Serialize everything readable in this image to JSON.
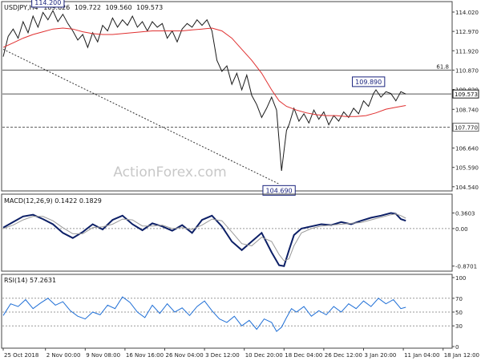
{
  "chart_data": [
    {
      "type": "line",
      "panel": "price",
      "instrument": "USDJPY,H4",
      "ohlc_readout": [
        "109.626",
        "109.722",
        "109.560",
        "109.573"
      ],
      "watermark": "ActionForex.com",
      "ylim": [
        104.4,
        114.5
      ],
      "y_ticks": [
        "114.020",
        "112.970",
        "111.920",
        "110.870",
        "109.820",
        "108.740",
        "107.690",
        "106.640",
        "105.590",
        "104.540"
      ],
      "series": [
        {
          "name": "",
          "color": "#1a1a1a",
          "x": [
            0,
            4,
            8,
            12,
            16,
            20,
            24,
            28,
            32,
            36,
            40,
            44,
            48,
            52,
            56,
            60,
            64,
            68,
            72,
            76,
            80,
            84,
            88,
            92,
            96,
            100,
            104,
            108,
            112,
            116,
            120,
            124,
            128,
            132,
            136,
            140,
            144,
            148,
            152,
            156,
            160,
            164,
            168,
            172,
            176,
            180,
            184,
            188,
            192,
            196,
            200,
            204,
            208,
            212,
            216,
            220,
            224,
            228,
            230,
            234,
            238,
            242,
            246,
            250,
            254,
            258,
            262,
            266,
            270,
            274,
            278,
            282,
            286,
            290,
            294,
            298,
            300,
            304,
            308,
            312,
            316,
            320,
            324
          ],
          "values": [
            111.6,
            112.7,
            113.1,
            112.6,
            113.5,
            112.9,
            113.8,
            113.2,
            114.0,
            113.6,
            114.1,
            113.5,
            113.9,
            113.4,
            113.0,
            112.5,
            112.8,
            112.1,
            112.9,
            112.4,
            113.3,
            113.0,
            113.7,
            113.2,
            113.6,
            113.3,
            113.8,
            113.2,
            113.5,
            113.0,
            113.5,
            113.2,
            113.4,
            112.6,
            113.0,
            112.4,
            113.1,
            113.4,
            113.2,
            113.6,
            113.3,
            113.6,
            113.0,
            111.4,
            110.8,
            111.1,
            110.1,
            110.7,
            109.8,
            110.6,
            109.5,
            109.0,
            108.3,
            108.8,
            109.4,
            108.7,
            105.4,
            107.6,
            107.9,
            108.8,
            108.1,
            108.5,
            108.0,
            108.7,
            108.2,
            108.6,
            107.9,
            108.4,
            108.1,
            108.6,
            108.3,
            108.8,
            108.5,
            109.2,
            108.9,
            109.6,
            109.8,
            109.4,
            109.7,
            109.6,
            109.2,
            109.7,
            109.57
          ]
        },
        {
          "name": "",
          "color": "#e03030",
          "x": [
            0,
            8,
            16,
            24,
            32,
            40,
            48,
            56,
            64,
            72,
            80,
            88,
            96,
            104,
            112,
            120,
            128,
            136,
            144,
            152,
            160,
            168,
            176,
            184,
            192,
            200,
            208,
            216,
            222,
            228,
            236,
            244,
            252,
            260,
            268,
            276,
            284,
            292,
            300,
            308,
            316,
            324
          ],
          "values": [
            112.1,
            112.35,
            112.6,
            112.8,
            112.95,
            113.1,
            113.15,
            113.1,
            112.95,
            112.85,
            112.8,
            112.8,
            112.85,
            112.9,
            112.95,
            113.0,
            113.0,
            113.0,
            113.0,
            113.05,
            113.1,
            113.15,
            113.0,
            112.6,
            112.0,
            111.4,
            110.7,
            109.8,
            109.2,
            108.9,
            108.7,
            108.55,
            108.45,
            108.4,
            108.4,
            108.35,
            108.35,
            108.4,
            108.55,
            108.75,
            108.85,
            108.95
          ]
        }
      ],
      "annotations": [
        {
          "label": "114.200",
          "x": 36,
          "y": 114.2
        },
        {
          "label": "104.690",
          "x": 222,
          "y": 104.69
        },
        {
          "label": "109.890",
          "x": 294,
          "y": 109.89
        }
      ],
      "price_tags": [
        {
          "label": "109.573",
          "y": 109.573,
          "kind": "current"
        },
        {
          "label": "107.770",
          "y": 107.77,
          "kind": "support"
        }
      ],
      "levels": [
        {
          "label": "61.8",
          "y": 110.87,
          "style": "solid"
        },
        {
          "label": "",
          "y": 109.573,
          "style": "solid"
        },
        {
          "label": "",
          "y": 107.77,
          "style": "dashed"
        }
      ],
      "trendline": {
        "x": [
          0,
          222
        ],
        "values": [
          112.0,
          104.69
        ]
      }
    },
    {
      "type": "line",
      "panel": "macd",
      "title": "MACD(12,26,9) 0.1422 0.1829",
      "ylim": [
        -0.95,
        0.5
      ],
      "y_ticks": [
        {
          "label": "0.3603",
          "value": 0.3603
        },
        {
          "label": "0.00",
          "value": 0.0
        },
        {
          "label": "-0.8701",
          "value": -0.8701
        }
      ],
      "series": [
        {
          "name": "",
          "color": "#0c1f66",
          "x": [
            0,
            8,
            16,
            24,
            32,
            40,
            48,
            56,
            64,
            72,
            80,
            88,
            96,
            104,
            112,
            120,
            128,
            136,
            144,
            152,
            160,
            168,
            176,
            184,
            192,
            200,
            208,
            216,
            222,
            226,
            230,
            234,
            240,
            248,
            256,
            264,
            272,
            280,
            288,
            296,
            304,
            312,
            316,
            320,
            324
          ],
          "values": [
            0.02,
            0.15,
            0.28,
            0.32,
            0.22,
            0.1,
            -0.1,
            -0.22,
            -0.08,
            0.1,
            -0.02,
            0.2,
            0.3,
            0.1,
            -0.04,
            0.12,
            0.05,
            -0.05,
            0.08,
            -0.1,
            0.2,
            0.3,
            0.05,
            -0.3,
            -0.5,
            -0.3,
            -0.1,
            -0.55,
            -0.85,
            -0.87,
            -0.5,
            -0.15,
            0.0,
            0.05,
            0.1,
            0.08,
            0.15,
            0.1,
            0.18,
            0.25,
            0.3,
            0.36,
            0.34,
            0.22,
            0.18
          ]
        },
        {
          "name": "",
          "color": "#9a9a9a",
          "x": [
            0,
            8,
            16,
            24,
            32,
            40,
            48,
            56,
            64,
            72,
            80,
            88,
            96,
            104,
            112,
            120,
            128,
            136,
            144,
            152,
            160,
            168,
            176,
            184,
            192,
            200,
            208,
            216,
            222,
            226,
            230,
            234,
            240,
            248,
            256,
            264,
            272,
            280,
            288,
            296,
            304,
            312,
            316,
            320,
            324
          ],
          "values": [
            0.0,
            0.08,
            0.2,
            0.28,
            0.28,
            0.18,
            0.02,
            -0.12,
            -0.12,
            0.02,
            0.04,
            0.1,
            0.22,
            0.2,
            0.06,
            0.06,
            0.08,
            0.0,
            0.02,
            -0.02,
            0.08,
            0.22,
            0.18,
            -0.08,
            -0.35,
            -0.4,
            -0.2,
            -0.3,
            -0.6,
            -0.75,
            -0.7,
            -0.4,
            -0.1,
            0.0,
            0.06,
            0.08,
            0.1,
            0.12,
            0.14,
            0.2,
            0.26,
            0.32,
            0.34,
            0.3,
            0.24
          ]
        }
      ]
    },
    {
      "type": "line",
      "panel": "rsi",
      "title": "RSI(14) 57.2631",
      "ylim": [
        0,
        100
      ],
      "y_ticks": [
        {
          "label": "100",
          "value": 100
        },
        {
          "label": "70",
          "value": 70
        },
        {
          "label": "50",
          "value": 50
        },
        {
          "label": "30",
          "value": 30
        },
        {
          "label": "0",
          "value": 0
        }
      ],
      "reference_lines": [
        70,
        50,
        30
      ],
      "series": [
        {
          "name": "",
          "color": "#1f6fd6",
          "x": [
            0,
            6,
            12,
            18,
            24,
            30,
            36,
            42,
            48,
            54,
            60,
            66,
            72,
            78,
            84,
            90,
            96,
            102,
            108,
            114,
            120,
            126,
            132,
            138,
            144,
            150,
            156,
            162,
            168,
            174,
            180,
            186,
            192,
            198,
            204,
            210,
            216,
            220,
            224,
            228,
            232,
            236,
            242,
            248,
            254,
            260,
            266,
            272,
            278,
            284,
            290,
            296,
            302,
            308,
            314,
            320,
            324
          ],
          "values": [
            45,
            62,
            58,
            68,
            55,
            63,
            70,
            60,
            65,
            52,
            44,
            40,
            50,
            46,
            60,
            55,
            72,
            64,
            50,
            42,
            60,
            48,
            62,
            50,
            56,
            45,
            58,
            66,
            52,
            40,
            35,
            44,
            30,
            38,
            25,
            40,
            35,
            22,
            28,
            42,
            55,
            50,
            58,
            44,
            52,
            46,
            58,
            50,
            62,
            55,
            66,
            58,
            70,
            62,
            68,
            55,
            57
          ]
        }
      ]
    }
  ],
  "x_ticks": [
    {
      "label": "25 Oct 2018",
      "x": 0
    },
    {
      "label": "2 Nov 00:00",
      "x": 34
    },
    {
      "label": "9 Nov 08:00",
      "x": 66
    },
    {
      "label": "16 Nov 16:00",
      "x": 98
    },
    {
      "label": "26 Nov 04:00",
      "x": 130
    },
    {
      "label": "3 Dec 12:00",
      "x": 162
    },
    {
      "label": "10 Dec 20:00",
      "x": 194
    },
    {
      "label": "18 Dec 04:00",
      "x": 226
    },
    {
      "label": "26 Dec 12:00",
      "x": 258
    },
    {
      "label": "3 Jan 20:00",
      "x": 290
    },
    {
      "label": "11 Jan 04:00",
      "x": 322
    },
    {
      "label": "18 Jan 12:00",
      "x": 354
    }
  ]
}
